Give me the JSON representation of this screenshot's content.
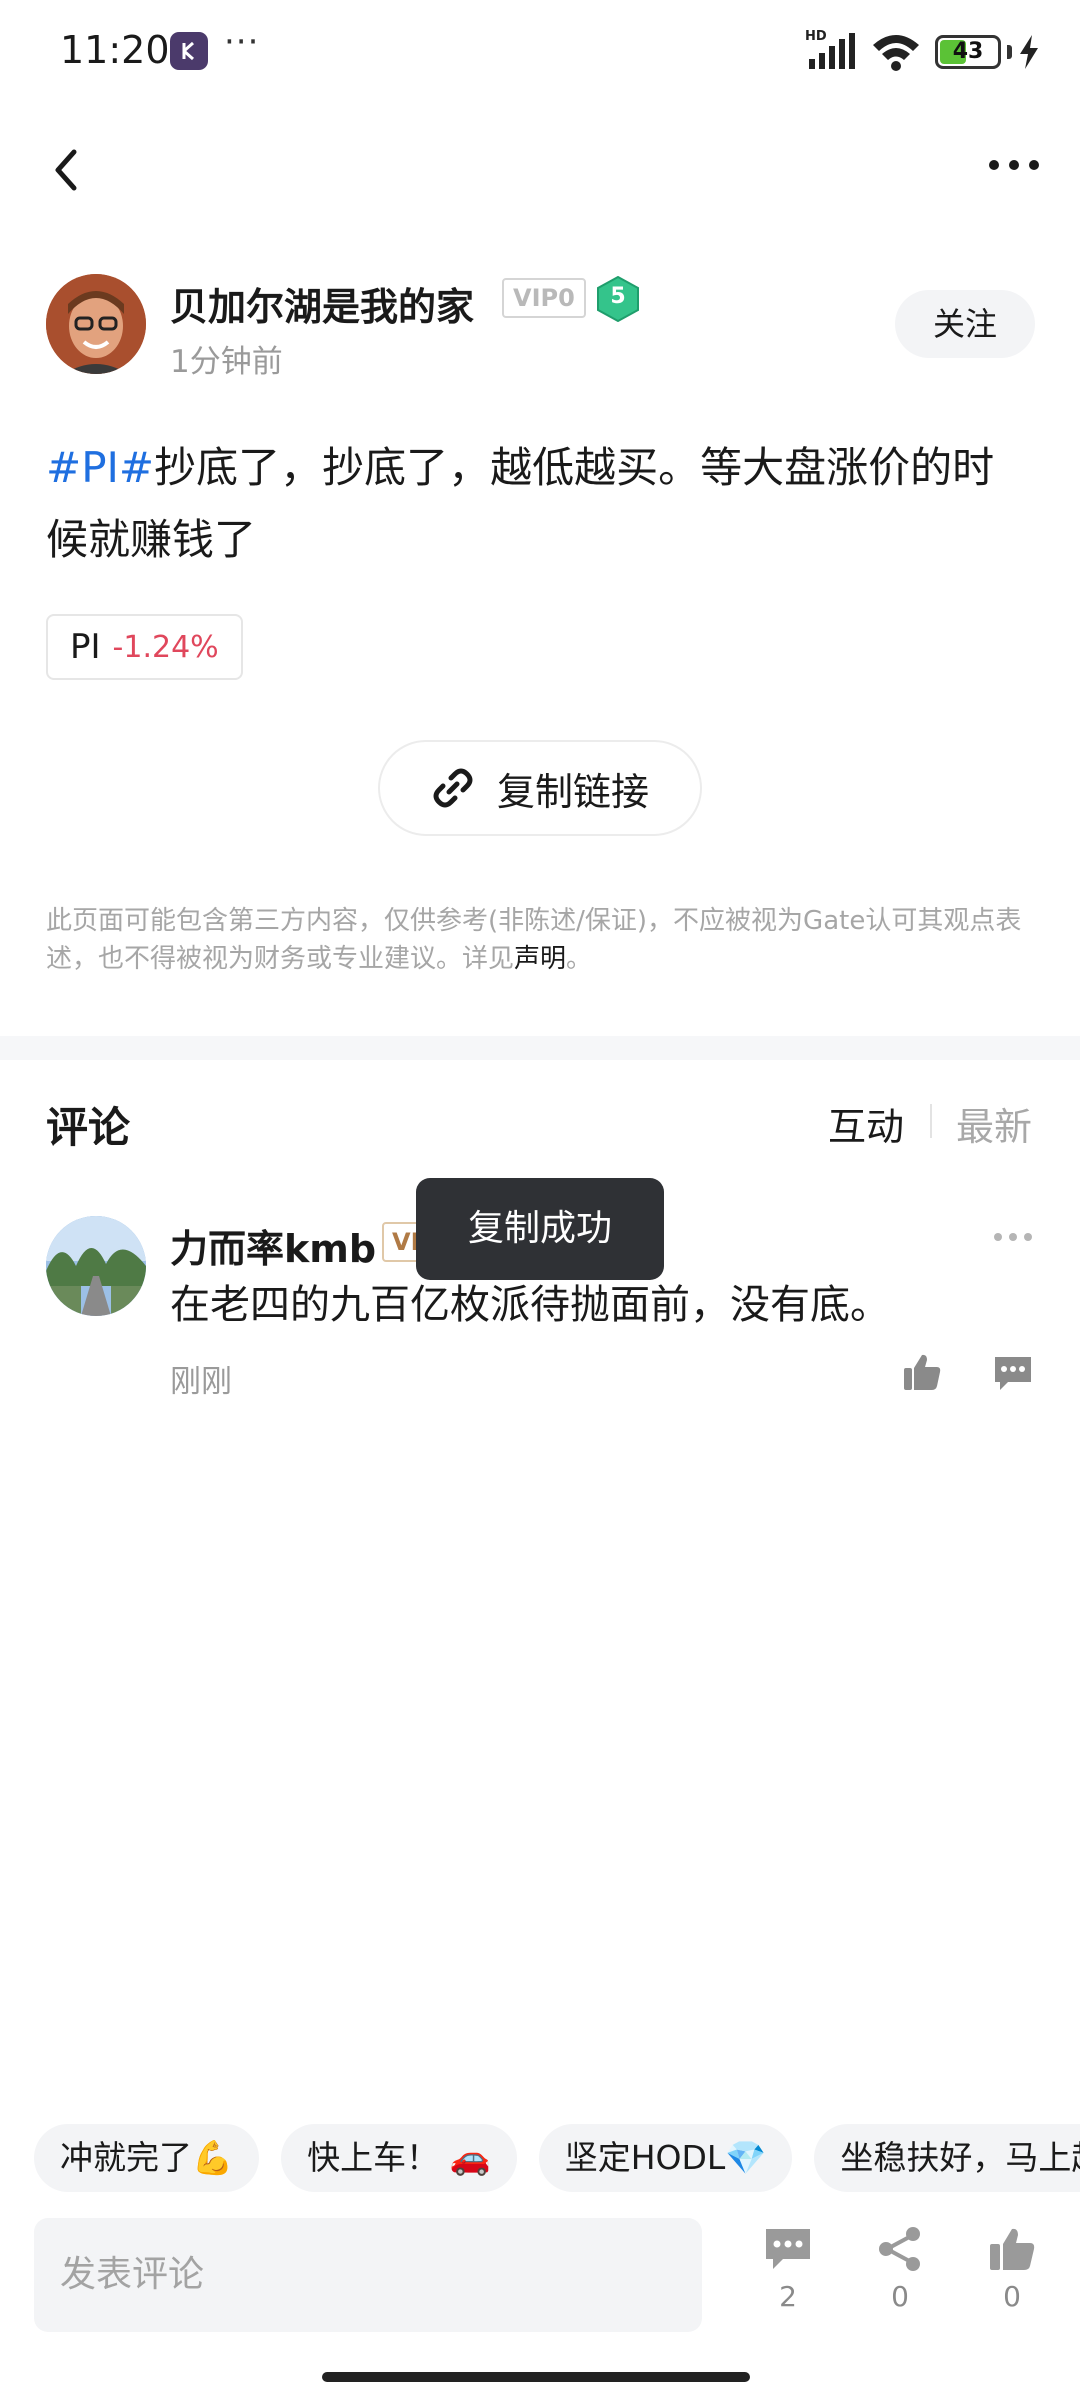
{
  "status_bar": {
    "time": "11:20",
    "dots": "···",
    "hd": "HD",
    "battery": "43"
  },
  "author": {
    "name": "贝加尔湖是我的家",
    "vip": "VIP0",
    "level": "5",
    "time": "1分钟前",
    "follow_label": "关注"
  },
  "post": {
    "hashtag": "#PI#",
    "text": "抄底了，抄底了，越低越买。等大盘涨价的时候就赚钱了",
    "coin_symbol": "PI",
    "coin_change": "-1.24%",
    "copy_link_label": "复制链接"
  },
  "disclaimer": {
    "text": "此页面可能包含第三方内容，仅供参考(非陈述/保证)，不应被视为Gate认可其观点表述，也不得被视为财务或专业建议。详见",
    "link": "声明",
    "end": "。"
  },
  "comments": {
    "title": "评论",
    "sort_hot": "互动",
    "sort_new": "最新",
    "items": [
      {
        "user": "力而率kmb",
        "vip": "VIP",
        "text": "在老四的九百亿枚派待抛面前，没有底。",
        "time": "刚刚"
      }
    ]
  },
  "toast": "复制成功",
  "quick_replies": [
    "冲就完了💪",
    "快上车！ 🚗",
    "坚定HODL💎",
    "坐稳扶好，马上起飞"
  ],
  "input": {
    "placeholder": "发表评论"
  },
  "actions": {
    "comment_count": "2",
    "share_count": "0",
    "like_count": "0"
  },
  "colors": {
    "hashtag": "#1f6fe0",
    "negative": "#e0475c",
    "toast_bg": "#2f3135"
  }
}
